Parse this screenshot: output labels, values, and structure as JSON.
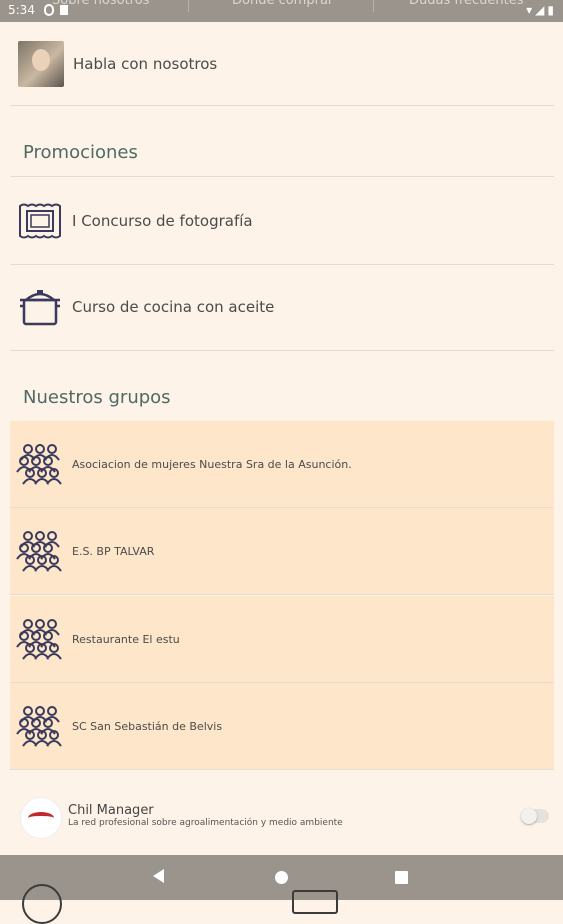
{
  "status_bar": {
    "time": "5:34",
    "peek_tabs": [
      "Sobre nosotros",
      "Donde comprar",
      "Dudas frecuentes"
    ]
  },
  "contact": {
    "label": "Habla con nosotros",
    "icon": "person-photo"
  },
  "promotions": {
    "title": "Promociones",
    "items": [
      {
        "label": "I Concurso de fotografía",
        "icon": "picture-frame-icon"
      },
      {
        "label": "Curso de cocina con aceite",
        "icon": "cooking-pot-icon"
      }
    ]
  },
  "groups": {
    "title": "Nuestros grupos",
    "items": [
      {
        "label": "Asociacion de mujeres Nuestra Sra de la Asunción."
      },
      {
        "label": "E.S. BP TALVAR"
      },
      {
        "label": "Restaurante El estu"
      },
      {
        "label": "SC San Sebastián de Belvis"
      }
    ],
    "icon": "people-group-icon"
  },
  "footer": {
    "name": "Chil Manager",
    "description": "La red profesional sobre agroalimentación y medio ambiente",
    "toggle_on": false
  },
  "colors": {
    "background": "#fdf3e8",
    "group_highlight": "#fde6c9",
    "section_title": "#4f6a64",
    "icon_stroke": "#3a3a5c",
    "system_bars": "#9a948d"
  }
}
